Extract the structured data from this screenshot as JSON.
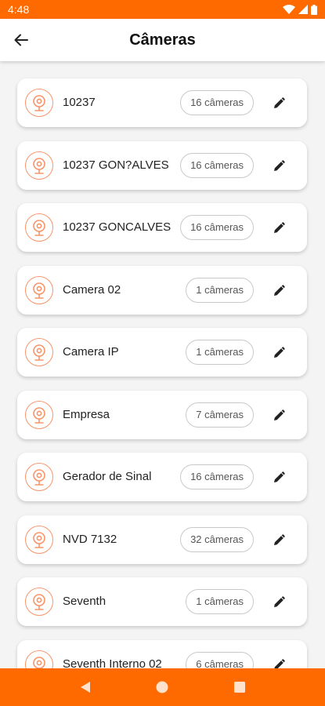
{
  "status_bar": {
    "time": "4:48"
  },
  "app_bar": {
    "title": "Câmeras"
  },
  "cameras": [
    {
      "name": "10237",
      "count": "16 câmeras"
    },
    {
      "name": "10237 GON?ALVES",
      "count": "16 câmeras"
    },
    {
      "name": "10237 GONCALVES",
      "count": "16 câmeras"
    },
    {
      "name": "Camera 02",
      "count": "1 câmeras"
    },
    {
      "name": "Camera IP",
      "count": "1 câmeras"
    },
    {
      "name": "Empresa",
      "count": "7 câmeras"
    },
    {
      "name": "Gerador de Sinal",
      "count": "16 câmeras"
    },
    {
      "name": "NVD 7132",
      "count": "32 câmeras"
    },
    {
      "name": "Seventh",
      "count": "1 câmeras"
    },
    {
      "name": "Seventh Interno 02",
      "count": "6 câmeras"
    }
  ],
  "colors": {
    "accent": "#ff6a00",
    "icon_outline": "#f7956a"
  },
  "icons": {
    "back": "arrow-left-icon",
    "camera": "webcam-icon",
    "edit": "pencil-icon",
    "nav": [
      "back-triangle-icon",
      "home-circle-icon",
      "recents-square-icon"
    ]
  }
}
